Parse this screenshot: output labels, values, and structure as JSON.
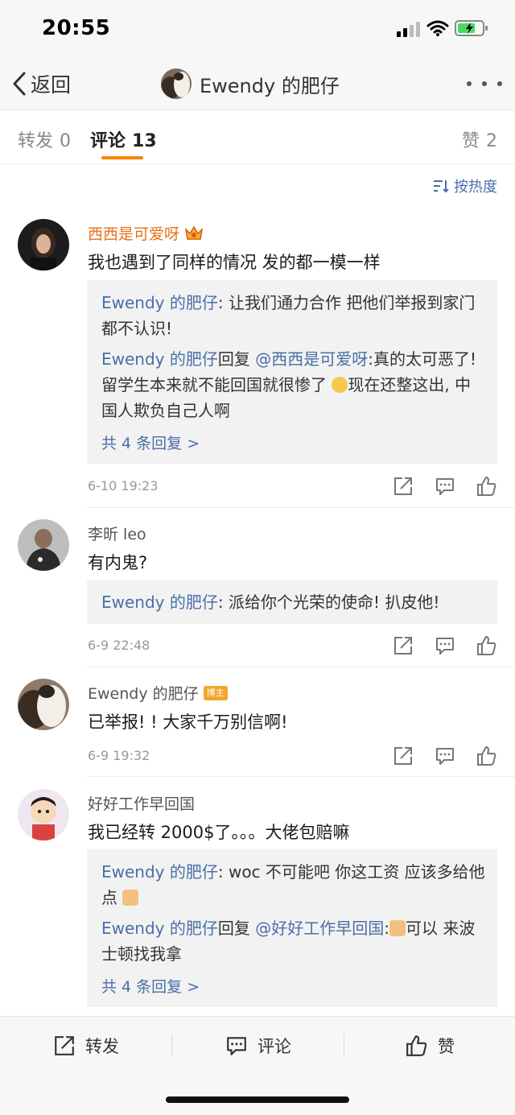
{
  "status_bar": {
    "time": "20:55"
  },
  "nav": {
    "back_label": "返回",
    "title": "Ewendy 的肥仔"
  },
  "tabs": {
    "repost": {
      "label": "转发",
      "count": "0"
    },
    "comment": {
      "label": "评论",
      "count": "13"
    },
    "like": {
      "label": "赞",
      "count": "2"
    }
  },
  "sort": {
    "label": "按热度"
  },
  "comments": [
    {
      "user": "西西是可爱呀",
      "text": "我也遇到了同样的情况 发的都一模一样",
      "time": "6-10 19:23",
      "replies": [
        {
          "name": "Ewendy 的肥仔",
          "text": ": 让我们通力合作 把他们举报到家门都不认识!"
        },
        {
          "name": "Ewendy 的肥仔",
          "mid": "回复",
          "target": "@西西是可爱呀",
          "text": ":真的太可恶了! 留学生本来就不能回国就很惨了",
          "text2": "现在还整这出, 中国人欺负自己人啊"
        }
      ],
      "more": "共 4 条回复 >"
    },
    {
      "user": "李昕 leo",
      "text": "有内鬼?",
      "time": "6-9 22:48",
      "replies": [
        {
          "name": "Ewendy 的肥仔",
          "text": ": 派给你个光荣的使命! 扒皮他!"
        }
      ]
    },
    {
      "user": "Ewendy 的肥仔",
      "badge": "博主",
      "text": "已举报! ! 大家千万别信啊!",
      "time": "6-9 19:32"
    },
    {
      "user": "好好工作早回国",
      "text": "我已经转 2000$了。。。大佬包赔嘛",
      "replies": [
        {
          "name": "Ewendy 的肥仔",
          "text": ": woc 不可能吧 你这工资 应该多给他点"
        },
        {
          "name": "Ewendy 的肥仔",
          "mid": "回复",
          "target": "@好好工作早回国",
          "text": ":",
          "text2": "可以 来波士顿找我拿"
        }
      ],
      "more": "共 4 条回复 >"
    }
  ],
  "toolbar": {
    "repost": "转发",
    "comment": "评论",
    "like": "赞"
  },
  "colors": {
    "accent": "#ff8200",
    "link": "#4a6ea9",
    "username_vip": "#ea6f1b"
  }
}
